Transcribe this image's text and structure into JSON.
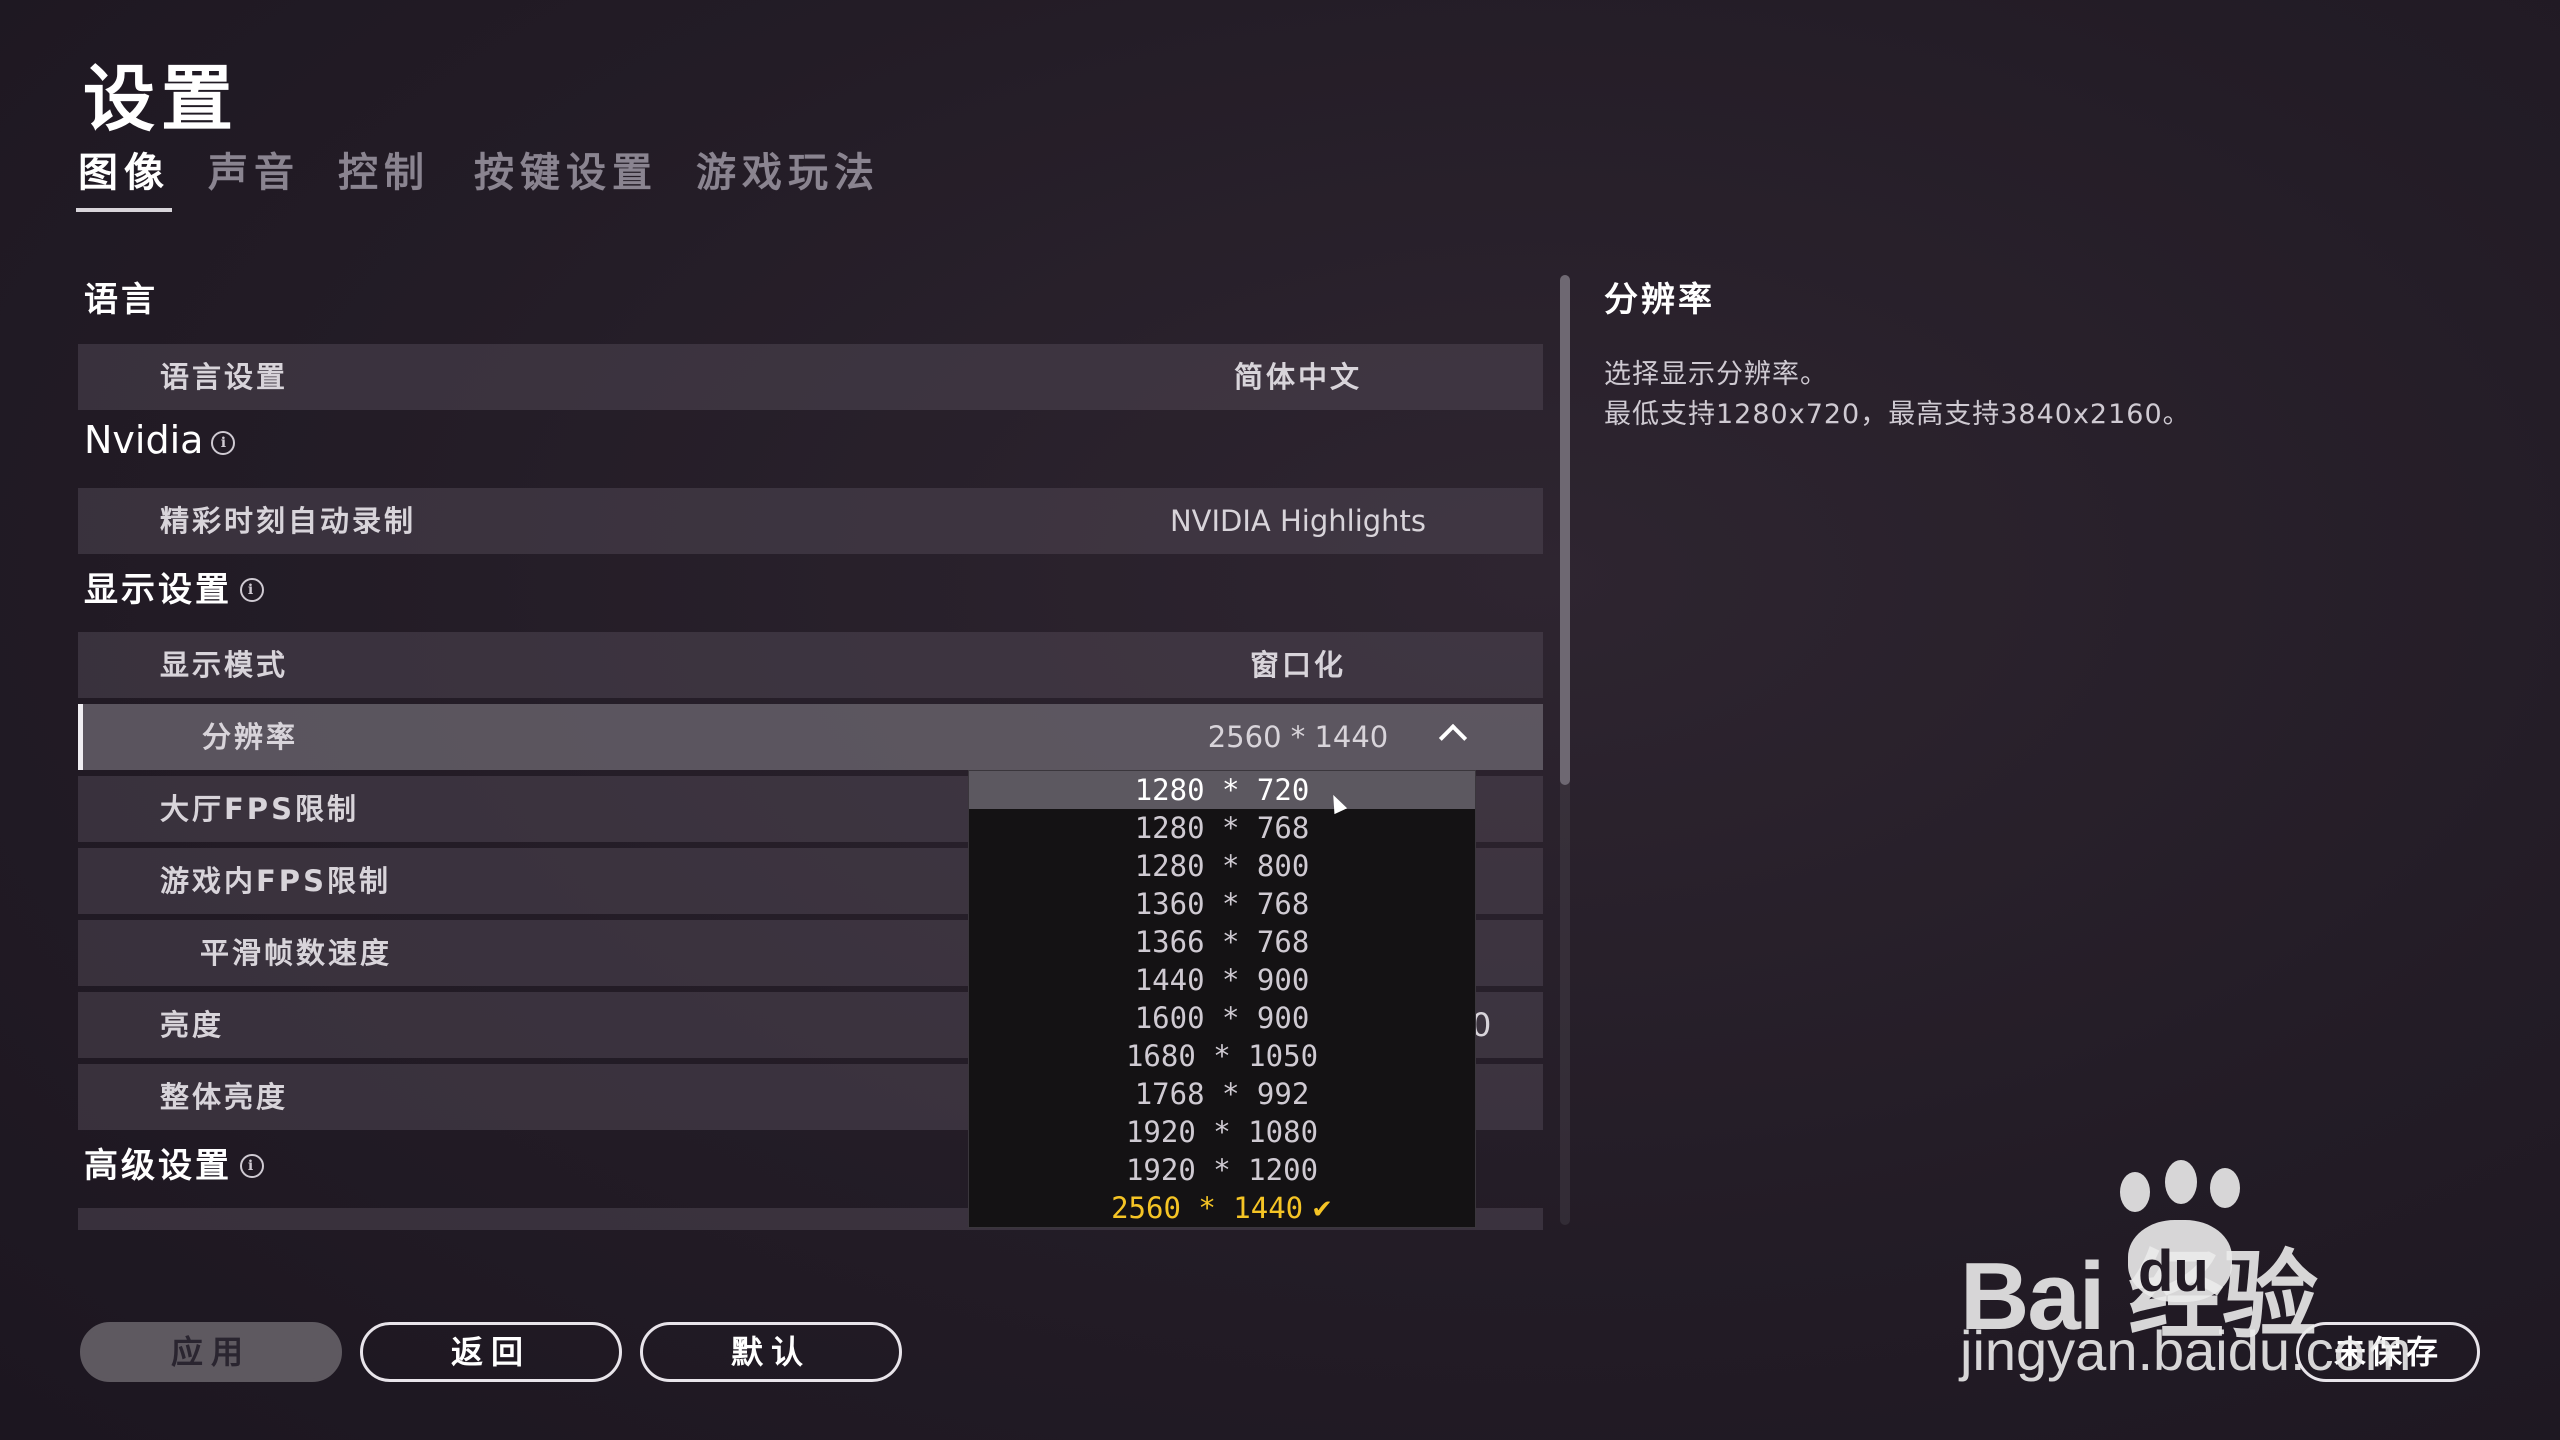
{
  "header": {
    "title": "设置",
    "tabs": [
      {
        "label": "图像",
        "active": true
      },
      {
        "label": "声音",
        "active": false
      },
      {
        "label": "控制",
        "active": false
      },
      {
        "label": "按键设置",
        "active": false
      },
      {
        "label": "游戏玩法",
        "active": false
      }
    ]
  },
  "sections": {
    "language": {
      "title": "语言",
      "rows": [
        {
          "label": "语言设置",
          "value": "简体中文"
        }
      ]
    },
    "nvidia": {
      "title": "Nvidia",
      "rows": [
        {
          "label": "精彩时刻自动录制",
          "value": "NVIDIA Highlights"
        }
      ]
    },
    "display": {
      "title": "显示设置",
      "rows": [
        {
          "label": "显示模式",
          "value": "窗口化"
        },
        {
          "label": "分辨率",
          "value": "2560 * 1440"
        },
        {
          "label": "大厅FPS限制",
          "value": ""
        },
        {
          "label": "游戏内FPS限制",
          "value": ""
        },
        {
          "label": "平滑帧数速度",
          "value": ""
        },
        {
          "label": "亮度",
          "value": "0"
        },
        {
          "label": "整体亮度",
          "value": ""
        }
      ]
    },
    "advanced": {
      "title": "高级设置"
    }
  },
  "dropdown": {
    "options": [
      "1280 * 720",
      "1280 * 768",
      "1280 * 800",
      "1360 * 768",
      "1366 * 768",
      "1440 * 900",
      "1600 * 900",
      "1680 * 1050",
      "1768 * 992",
      "1920 * 1080",
      "1920 * 1200",
      "2560 * 1440"
    ],
    "hovered": "1280 * 720",
    "selected": "2560 * 1440",
    "check_glyph": "✔"
  },
  "description": {
    "title": "分辨率",
    "line1": "选择显示分辨率。",
    "line2": "最低支持1280x720，最高支持3840x2160。"
  },
  "buttons": {
    "apply": "应用",
    "back": "返回",
    "default": "默认",
    "unsaved": "未保存"
  },
  "watermark": {
    "brand": "Bai  经验",
    "brand_du": "du",
    "url": "jingyan.baidu.com"
  },
  "colors": {
    "accent_selected": "#f5c425",
    "background": "#231c26"
  }
}
